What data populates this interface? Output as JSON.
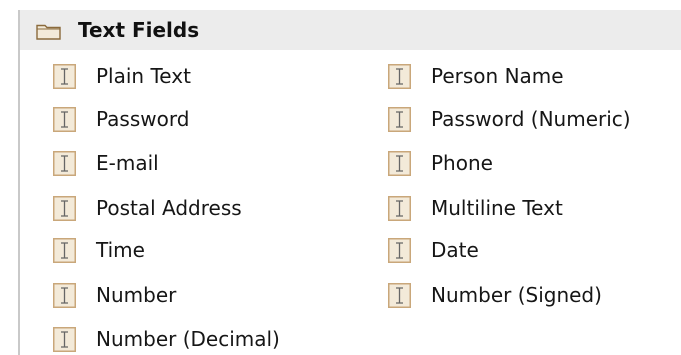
{
  "category": {
    "title": "Text Fields",
    "icon": "folder-icon"
  },
  "widgets": {
    "icon": "text-cursor-icon",
    "items": [
      "Plain Text",
      "Person Name",
      "Password",
      "Password (Numeric)",
      "E-mail",
      "Phone",
      "Postal Address",
      "Multiline Text",
      "Time",
      "Date",
      "Number",
      "Number (Signed)",
      "Number (Decimal)"
    ]
  },
  "colors": {
    "header_background": "#ececec",
    "icon_border": "#c9a77a",
    "icon_fill": "#f3ead9",
    "text": "#161616"
  }
}
